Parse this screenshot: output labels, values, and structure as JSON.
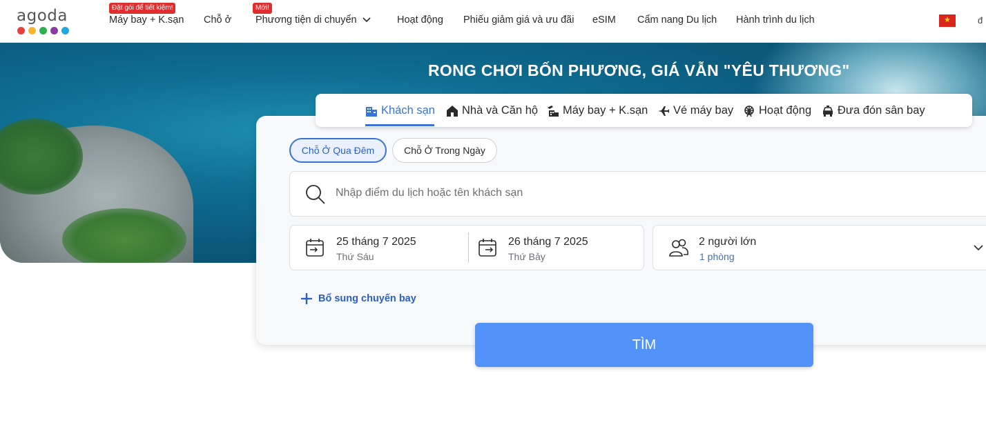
{
  "brand": {
    "logo_text": "agoda",
    "dot_colors": [
      "#e8413d",
      "#f7b52b",
      "#2bb24c",
      "#8b3aa5",
      "#1ea7e0"
    ]
  },
  "nav": {
    "items": [
      {
        "label": "Máy bay + K.sạn",
        "badge": "Đặt gói để tiết kiệm!"
      },
      {
        "label": "Chỗ ở"
      },
      {
        "label": "Phương tiện di chuyển",
        "badge": "Mới!"
      },
      {
        "label": "Hoạt động"
      },
      {
        "label": "Phiếu giảm giá và ưu đãi"
      },
      {
        "label": "eSIM"
      },
      {
        "label": "Cẩm nang Du lịch"
      },
      {
        "label": "Hành trình du lịch"
      }
    ],
    "cut_text": "đ"
  },
  "hero": {
    "title": "RONG CHƠI BỐN PHƯƠNG, GIÁ VẪN \"YÊU THƯƠNG\""
  },
  "tabs": [
    {
      "label": "Khách sạn",
      "icon": "hotel-icon",
      "active": true
    },
    {
      "label": "Nhà và Căn hộ",
      "icon": "house-icon"
    },
    {
      "label": "Máy bay + K.sạn",
      "icon": "flight-hotel-icon"
    },
    {
      "label": "Vé máy bay",
      "icon": "plane-icon"
    },
    {
      "label": "Hoạt động",
      "icon": "ferris-wheel-icon"
    },
    {
      "label": "Đưa đón sân bay",
      "icon": "car-icon"
    }
  ],
  "stay_type": {
    "overnight": "Chỗ Ở Qua Đêm",
    "day_use": "Chỗ Ở Trong Ngày"
  },
  "search": {
    "placeholder": "Nhập điểm du lịch hoặc tên khách sạn"
  },
  "dates": {
    "checkin": {
      "date": "25 tháng 7 2025",
      "day": "Thứ Sáu"
    },
    "checkout": {
      "date": "26 tháng 7 2025",
      "day": "Thứ Bảy"
    }
  },
  "guests": {
    "adults": "2 người lớn",
    "rooms": "1 phòng"
  },
  "add_flight_label": "Bổ sung chuyến bay",
  "search_button_label": "TÌM",
  "colors": {
    "accent": "#3a73d6",
    "search_button": "#5392f9",
    "badge": "#e12d2d"
  }
}
